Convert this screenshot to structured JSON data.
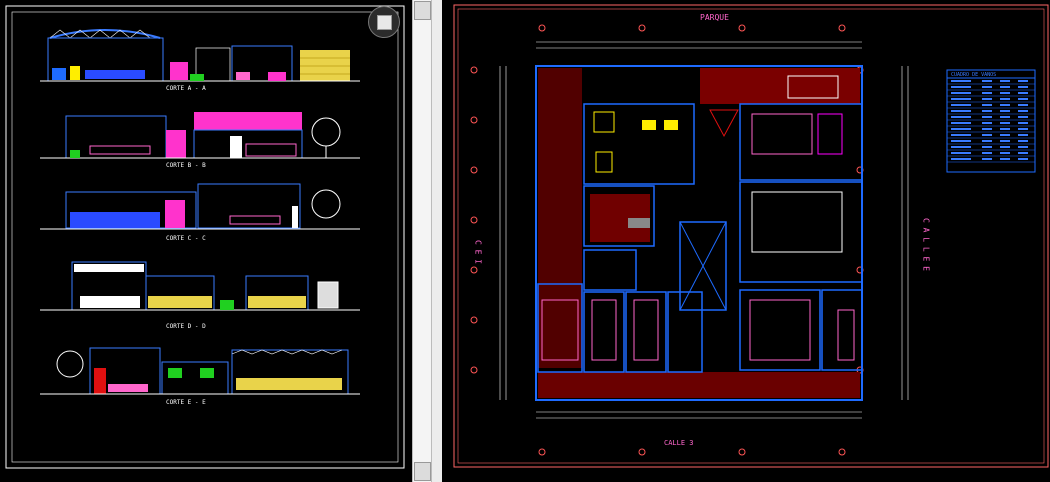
{
  "left_sheet": {
    "sections": [
      {
        "label": "CORTE A - A"
      },
      {
        "label": "CORTE B - B"
      },
      {
        "label": "CORTE C - C"
      },
      {
        "label": "CORTE D - D"
      },
      {
        "label": "CORTE E - E"
      }
    ],
    "maximize_button": "maximize"
  },
  "plan": {
    "top_label": "PARQUE",
    "bottom_label": "CALLE 3",
    "left_label": "C E I",
    "right_label": "C A L L E  E",
    "legend_title": "CUADRO DE VANOS",
    "legend_rows": 14
  },
  "colors": {
    "background": "#000000",
    "frame": "#ffffff",
    "wall": "#1e6bff",
    "pink": "#ff66cc",
    "red": "#e01010",
    "yellow": "#ffee00",
    "green": "#20d020",
    "magenta": "#ff00ff"
  },
  "icons": {
    "scroll_up": "triangle-up-icon",
    "scroll_down": "triangle-down-icon"
  }
}
